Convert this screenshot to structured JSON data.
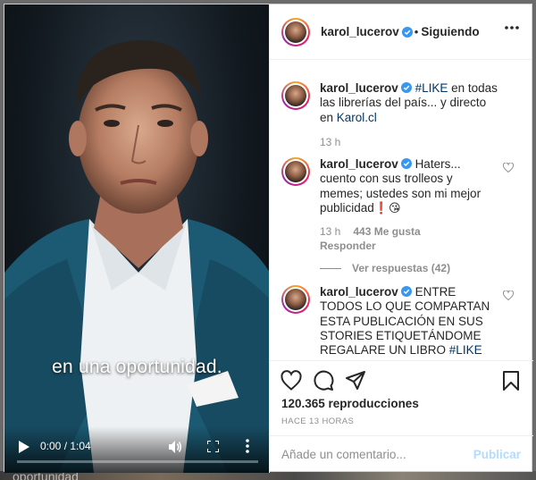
{
  "post": {
    "author": "karol_lucerov",
    "follow_status": "Siguiendo",
    "separator": "•"
  },
  "video": {
    "subtitle": "en una oportunidad.",
    "time": "0:00 / 1:04",
    "progress": 0
  },
  "background": {
    "caption_fragment": "oportunidad"
  },
  "comments": [
    {
      "username": "karol_lucerov",
      "parts": [
        {
          "text": "#LIKE",
          "type": "hashtag"
        },
        {
          "text": " en todas las librerías del país... y directo en ",
          "type": "text"
        },
        {
          "text": "Karol.cl",
          "type": "link"
        }
      ],
      "time": "13 h"
    },
    {
      "username": "karol_lucerov",
      "text": "Haters... cuento con sus trolleos y memes; ustedes son mi mejor publicidad",
      "emojis": "❗😘",
      "time": "13 h",
      "likes": "443 Me gusta",
      "reply_label": "Responder",
      "view_replies": "Ver respuestas (42)"
    },
    {
      "username": "karol_lucerov",
      "text": "ENTRE TODOS LO QUE COMPARTAN ESTA PUBLICACIÓN EN SUS STORIES ETIQUETÁNDOME REGALARE UN LIBRO ",
      "hashtag": "#LIKE"
    }
  ],
  "stats": {
    "views": "120.365 reproducciones",
    "posted_ago": "HACE 13 HORAS"
  },
  "composer": {
    "placeholder": "Añade un comentario...",
    "publish_label": "Publicar"
  },
  "icons": {
    "verified": "verified-badge-icon",
    "like": "heart-icon",
    "comment": "comment-bubble-icon",
    "share": "paper-plane-icon",
    "save": "bookmark-icon",
    "options": "more-horizontal-icon"
  },
  "colors": {
    "link": "#00376b",
    "verified": "#3897f0",
    "muted": "#8e8e8e",
    "publish_disabled": "#b3dbff"
  }
}
